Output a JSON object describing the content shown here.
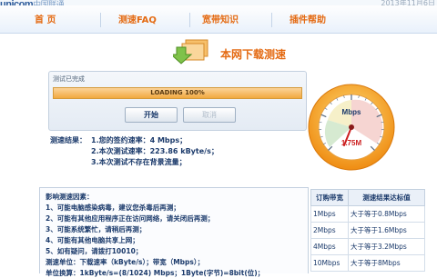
{
  "brand": {
    "name": "unicom",
    "name_cn": "中国联通"
  },
  "date_text": "2013年11月6日",
  "nav": [
    {
      "label": "首    页"
    },
    {
      "label": "测速FAQ"
    },
    {
      "label": "宽带知识"
    },
    {
      "label": "插件帮助"
    }
  ],
  "banner": {
    "title": "本网下载测速"
  },
  "panel": {
    "status": "测试已完成",
    "progress_label": "LOADING 100%",
    "progress": 1.0,
    "start_label": "开始",
    "cancel_label": "取消"
  },
  "gauge": {
    "unit": "Mbps",
    "readout": "1.75M",
    "value": 1.75
  },
  "result": {
    "title": "测速结果：",
    "lines": [
      "1.您的签约速率：4 Mbps；",
      "2.本次测试速率：223.86 kByte/s；",
      "3.本次测试不存在背景流量；"
    ]
  },
  "factors": {
    "title": "影响测速因素：",
    "items": [
      "1、可能电脑感染病毒，建议您杀毒后再测；",
      "2、可能有其他应用程序正在访问网络，请关闭后再测；",
      "3、可能系统繁忙，请稍后再测；",
      "4、可能有其他电脑共享上网；",
      "5、如有疑问，请拨打10010；",
      "测速单位：下载速率（kByte/s）；带宽（Mbps）；",
      "单位换算：1kByte/s=(8/1024) Mbps；1Byte(字节)=8bit(位)；"
    ]
  },
  "standard_table": {
    "headers": [
      "订购带宽",
      "测速结果达标值"
    ],
    "rows": [
      [
        "1Mbps",
        "大于等于0.8Mbps"
      ],
      [
        "2Mbps",
        "大于等于1.6Mbps"
      ],
      [
        "4Mbps",
        "大于等于3.2Mbps"
      ],
      [
        "10Mbps",
        "大于等于8Mbps"
      ]
    ]
  },
  "colors": {
    "nav_text": "#e46a12",
    "title_text": "#1b3a6b",
    "progress_fill": "#f2a93f",
    "gauge_ring": "#f29a1f"
  }
}
